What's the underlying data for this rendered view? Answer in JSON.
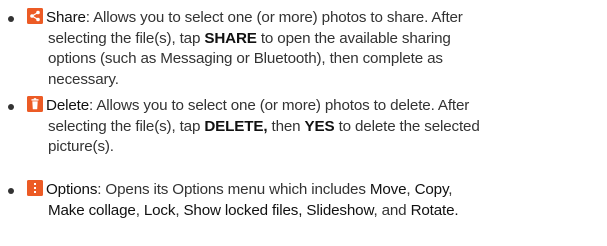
{
  "items": [
    {
      "icon": "share-icon",
      "term": "Share",
      "lines": [
        {
          "a": ": Allows you to select one (or more) photos to share. After"
        },
        {
          "a": "selecting the file(s), tap ",
          "b": "SHARE",
          "c": " to open the available sharing"
        },
        {
          "a": "options (such as Messaging or Bluetooth), then complete as"
        },
        {
          "a": "necessary."
        }
      ]
    },
    {
      "icon": "trash-icon",
      "term": "Delete",
      "lines": [
        {
          "a": ": Allows you to select one (or more) photos to delete. After"
        },
        {
          "a": "selecting the file(s), tap ",
          "b": "DELETE,",
          "c": " then ",
          "d": "YES",
          "e": " to delete the selected"
        },
        {
          "a": "picture(s)."
        }
      ]
    },
    {
      "icon": "more-vertical-icon",
      "term": "Options",
      "lines": [
        {
          "a": ": Opens its Options menu which includes ",
          "b": "Move",
          "c": ", ",
          "d": "Copy",
          "e": ","
        },
        {
          "a": "Make collage",
          "b": ", ",
          "c": "Lock",
          "d": ", ",
          "e": "Show locked files,",
          "f": " ",
          "g": "Slideshow",
          "h": ", and ",
          "i": "Rotate."
        }
      ]
    }
  ],
  "colors": {
    "icon_background": "#ec5b25",
    "text": "#333333"
  }
}
